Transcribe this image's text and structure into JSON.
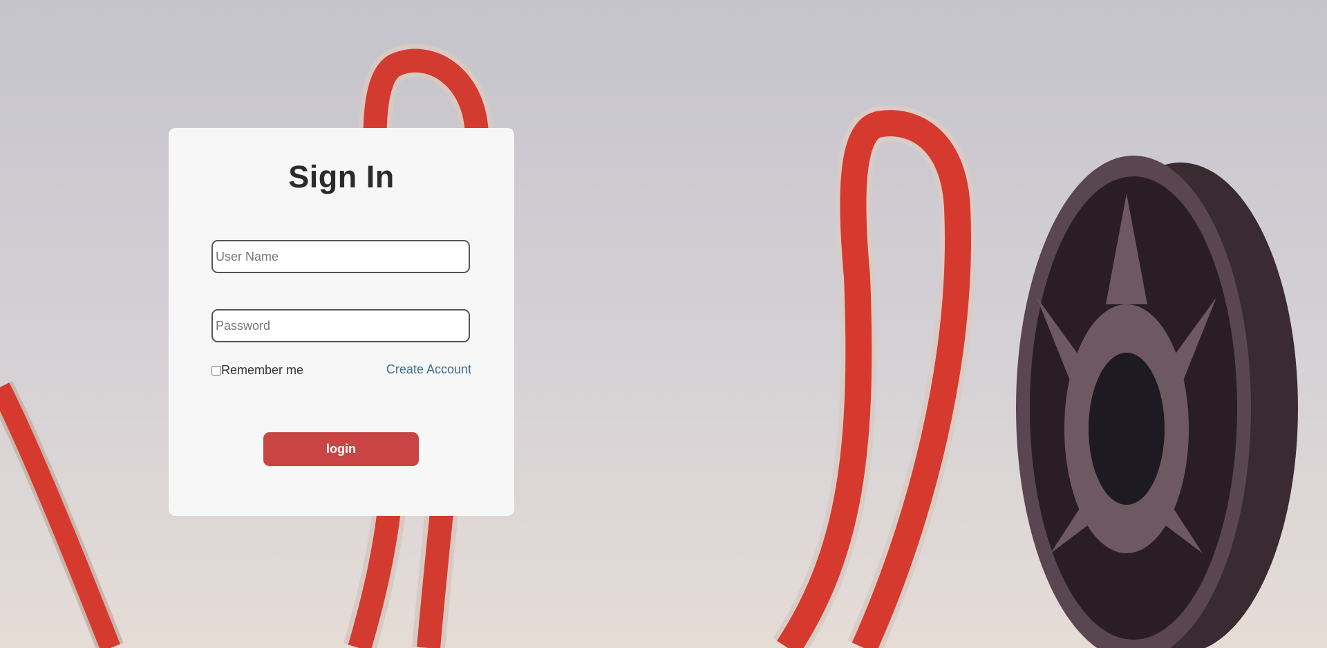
{
  "login_card": {
    "title": "Sign In",
    "username_placeholder": "User Name",
    "username_value": "",
    "password_placeholder": "Password",
    "password_value": "",
    "remember_label": "Remember me",
    "remember_checked": false,
    "create_account_label": "Create Account",
    "login_label": "login"
  },
  "colors": {
    "card_background": "#f7f7f7",
    "login_button": "#c94445",
    "link": "#3e6f93",
    "title_text": "#2b2b2b"
  },
  "icons": {
    "background_image": "film-reel-image"
  }
}
